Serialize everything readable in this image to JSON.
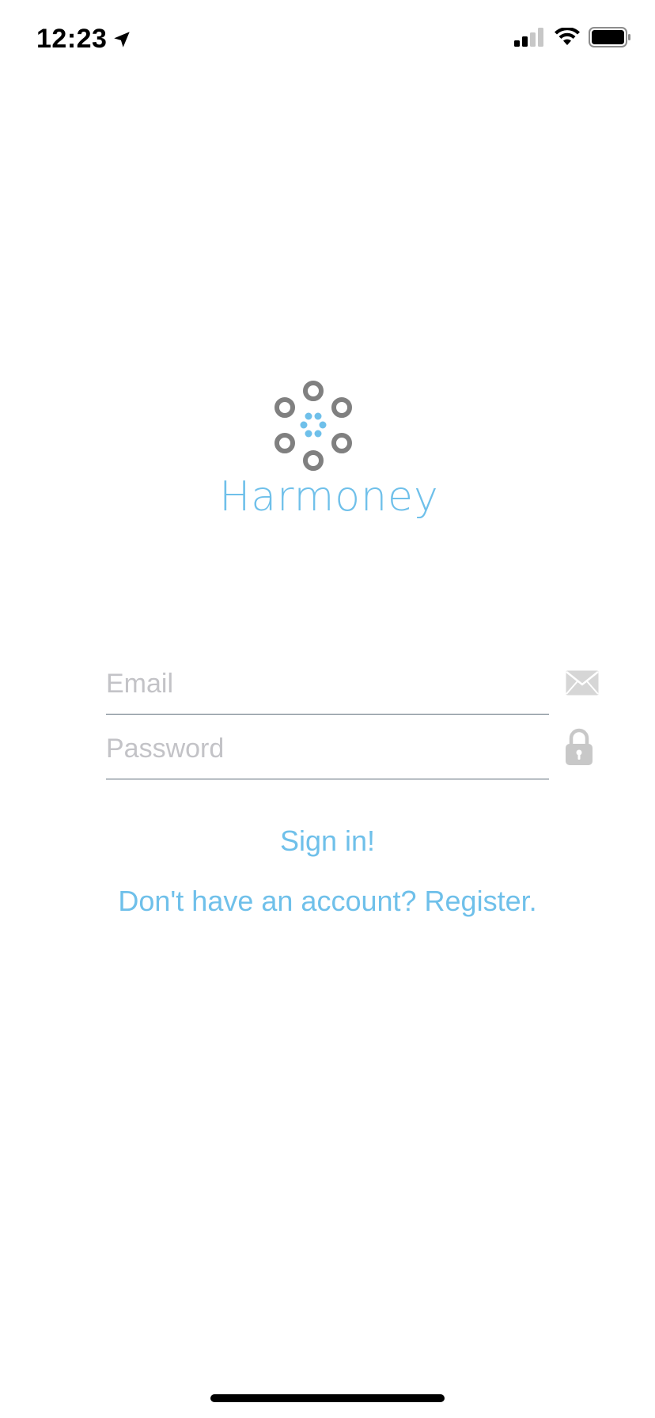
{
  "status_bar": {
    "time": "12:23",
    "location_icon": "location-arrow-icon",
    "signal_icon": "cellular-signal-icon",
    "wifi_icon": "wifi-icon",
    "battery_icon": "battery-icon"
  },
  "logo": {
    "icon": "harmoney-logo-icon",
    "text": "Harmoney"
  },
  "form": {
    "email_placeholder": "Email",
    "email_value": "",
    "email_icon": "envelope-icon",
    "password_placeholder": "Password",
    "password_value": "",
    "password_icon": "lock-icon"
  },
  "actions": {
    "sign_in_label": "Sign in!",
    "register_label": "Don't have an account? Register."
  },
  "colors": {
    "brand": "#6fc0ea",
    "logo_gray": "#808080",
    "placeholder": "#c3c3c7",
    "underline": "#5c6b78",
    "icon_gray": "#c8c8c8"
  }
}
